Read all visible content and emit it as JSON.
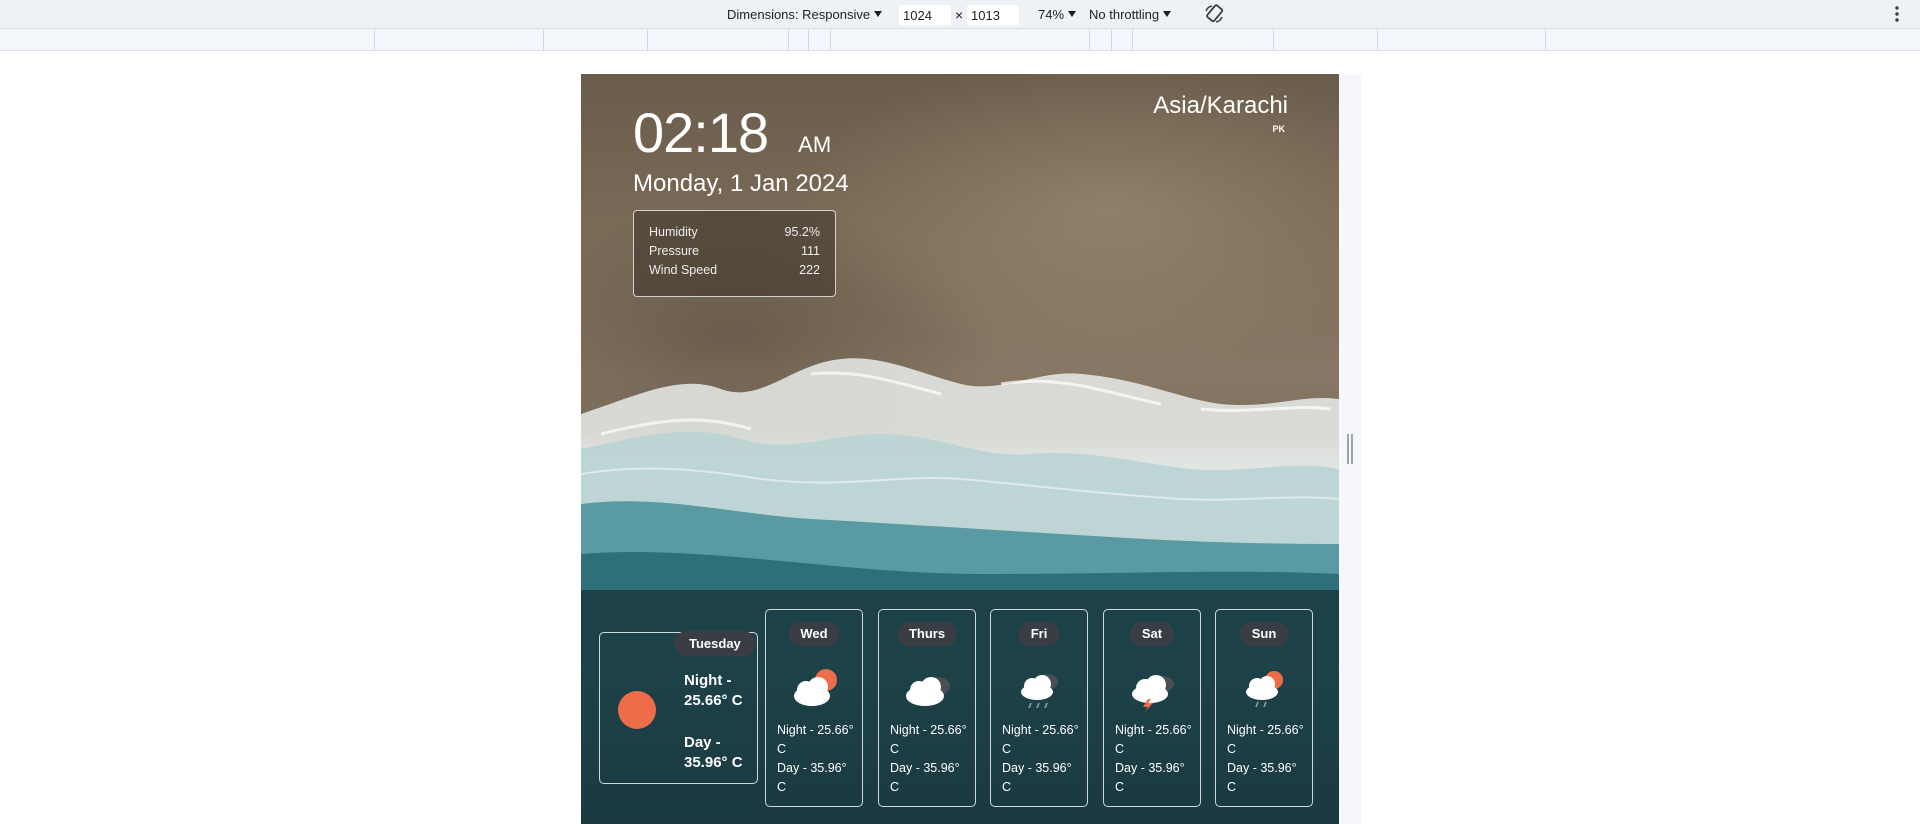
{
  "devtools": {
    "dimensions_label": "Dimensions: Responsive",
    "width": "1024",
    "times": "×",
    "height": "1013",
    "zoom": "74%",
    "throttling": "No throttling",
    "rotate_icon": "rotate-icon",
    "menu_icon": "kebab-menu-icon"
  },
  "app": {
    "time": "02:18",
    "ampm": "AM",
    "date": "Monday, 1 Jan 2024",
    "timezone": "Asia/Karachi",
    "country": "PK",
    "stats": [
      {
        "label": "Humidity",
        "value": "95.2%"
      },
      {
        "label": "Pressure",
        "value": "111"
      },
      {
        "label": "Wind Speed",
        "value": "222"
      }
    ],
    "today": {
      "day": "Tuesday",
      "icon": "sun-icon",
      "night": "Night - 25.66° C",
      "day_temp": "Day - 35.96° C"
    },
    "forecast": [
      {
        "day": "Wed",
        "icon": "cloud-sun-icon",
        "night": "Night - 25.66° C",
        "day_temp": "Day - 35.96° C"
      },
      {
        "day": "Thurs",
        "icon": "cloudy-icon",
        "night": "Night - 25.66° C",
        "day_temp": "Day - 35.96° C"
      },
      {
        "day": "Fri",
        "icon": "cloud-rain-icon",
        "night": "Night - 25.66° C",
        "day_temp": "Day - 35.96° C"
      },
      {
        "day": "Sat",
        "icon": "thunderstorm-icon",
        "night": "Night - 25.66° C",
        "day_temp": "Day - 35.96° C"
      },
      {
        "day": "Sun",
        "icon": "sun-cloud-rain-icon",
        "night": "Night - 25.66° C",
        "day_temp": "Day - 35.96° C"
      }
    ],
    "colors": {
      "accent_sun": "#ef6c48",
      "panel": "#18343a",
      "badge": "#3a3e44"
    }
  }
}
